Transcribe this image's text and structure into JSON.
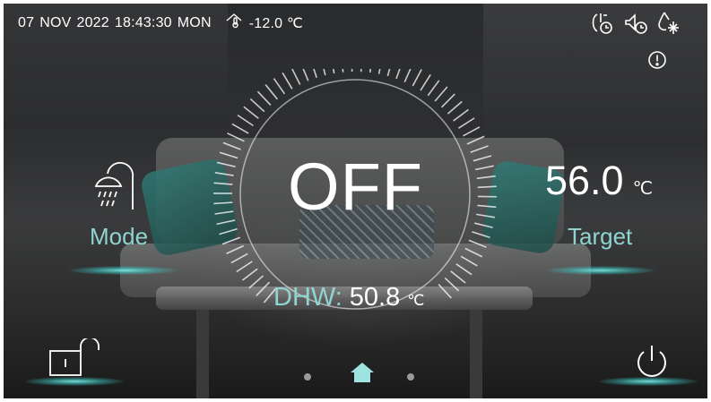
{
  "status": {
    "day": "07",
    "month": "NOV",
    "year": "2022",
    "time": "18:43:30",
    "weekday": "MON",
    "outdoor_temp": "-12.0 ℃"
  },
  "status_icons": [
    "timer-heat-icon",
    "silent-timer-icon",
    "defrost-icon",
    "alarm-icon"
  ],
  "main": {
    "power_state": "OFF",
    "dhw_label": "DHW:",
    "dhw_value": "50.8",
    "dhw_unit": "℃"
  },
  "mode": {
    "label": "Mode",
    "icon": "shower-icon"
  },
  "target": {
    "value": "56.0",
    "unit": "℃",
    "label": "Target"
  },
  "bottom": {
    "lock_icon": "unlock-icon",
    "power_icon": "power-icon",
    "pages": [
      "page-dot",
      "home-icon",
      "page-dot"
    ],
    "active_page": 1
  },
  "colors": {
    "accent": "#8fd4d0",
    "glow": "#6fe8e2",
    "text": "#ffffff",
    "home": "#9fe3e0"
  }
}
